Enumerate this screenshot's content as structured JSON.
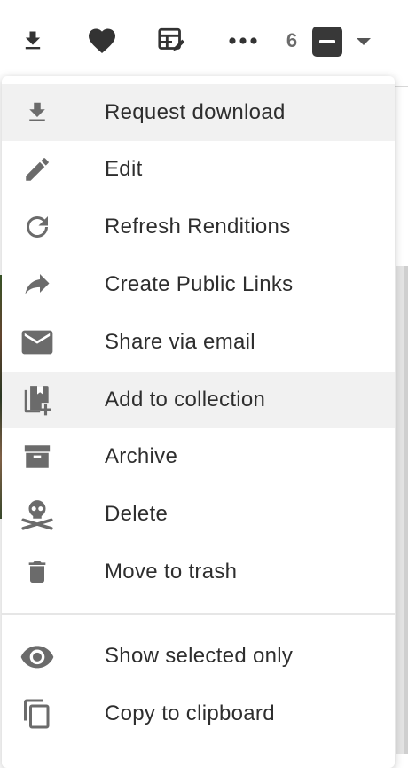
{
  "toolbar": {
    "selected_count": "6",
    "icons": [
      "download-icon",
      "heart-icon",
      "edit-metadata-icon",
      "more-icon",
      "select-toggle-icon",
      "caret-down-icon"
    ]
  },
  "menu": {
    "items": [
      {
        "label": "Request download",
        "icon": "download-icon"
      },
      {
        "label": "Edit",
        "icon": "pencil-icon"
      },
      {
        "label": "Refresh Renditions",
        "icon": "refresh-icon"
      },
      {
        "label": "Create Public Links",
        "icon": "share-arrow-icon"
      },
      {
        "label": "Share via email",
        "icon": "envelope-icon"
      },
      {
        "label": "Add to collection",
        "icon": "add-to-collection-icon"
      },
      {
        "label": "Archive",
        "icon": "archive-box-icon"
      },
      {
        "label": "Delete",
        "icon": "skull-icon"
      },
      {
        "label": "Move to trash",
        "icon": "trash-icon"
      },
      {
        "label": "Show selected only",
        "icon": "eye-icon"
      },
      {
        "label": "Copy to clipboard",
        "icon": "copy-icon"
      }
    ]
  },
  "colors": {
    "icon_dark": "#333333",
    "icon_grey": "#6b6b6b",
    "highlight_bg": "#f1f1f1"
  }
}
